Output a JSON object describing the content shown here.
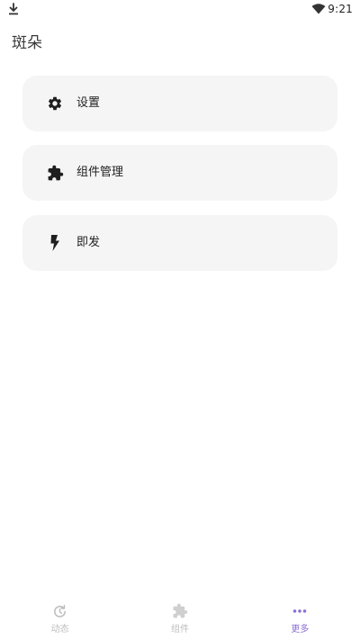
{
  "status_bar": {
    "time": "9:21",
    "download_icon": "download-icon",
    "wifi_icon": "wifi-icon"
  },
  "app": {
    "title": "斑朵"
  },
  "menu": {
    "items": [
      {
        "label": "设置",
        "icon": "gear-icon"
      },
      {
        "label": "组件管理",
        "icon": "puzzle-icon"
      },
      {
        "label": "即发",
        "icon": "bolt-icon"
      }
    ]
  },
  "bottom_nav": {
    "items": [
      {
        "label": "动态",
        "icon": "refresh-clock-icon",
        "active": false
      },
      {
        "label": "组件",
        "icon": "puzzle-icon",
        "active": false
      },
      {
        "label": "更多",
        "icon": "more-dots-icon",
        "active": true
      }
    ]
  },
  "colors": {
    "card_bg": "#f5f5f5",
    "accent": "#8b6fd6",
    "nav_inactive": "#bdbdbd",
    "text": "#222222"
  }
}
